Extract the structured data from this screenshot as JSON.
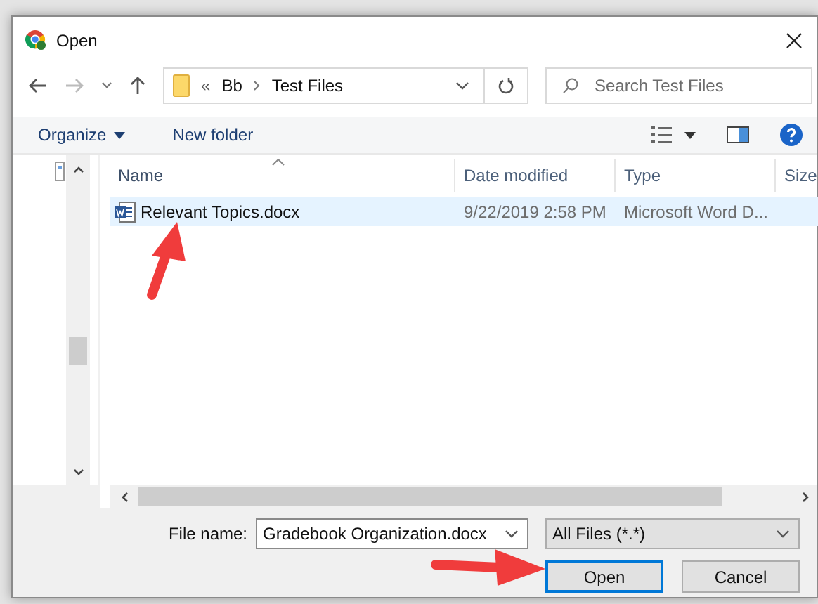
{
  "window": {
    "title": "Open"
  },
  "address_bar": {
    "path": [
      "«",
      "Bb",
      "Test Files"
    ]
  },
  "search": {
    "placeholder": "Search Test Files"
  },
  "toolbar": {
    "buttons": [
      {
        "label": "Organize",
        "kind": "menu"
      },
      {
        "label": "New folder",
        "kind": "plain"
      }
    ]
  },
  "table": {
    "columns": [
      {
        "label": "Name",
        "sorted": true
      },
      {
        "label": "Date modified",
        "sorted": false
      },
      {
        "label": "Type",
        "sorted": false
      },
      {
        "label": "Size",
        "sorted": false
      }
    ],
    "rows": [
      {
        "name": "Relevant Topics.docx",
        "date": "9/22/2019 2:58 PM",
        "type": "Microsoft Word D...",
        "selected": true
      }
    ]
  },
  "file_name": {
    "label": "File name:",
    "value": "Gradebook Organization.docx"
  },
  "file_type": {
    "value": "All Files (*.*)"
  },
  "buttons": [
    {
      "label": "Open",
      "default": true
    },
    {
      "label": "Cancel",
      "default": false
    }
  ]
}
